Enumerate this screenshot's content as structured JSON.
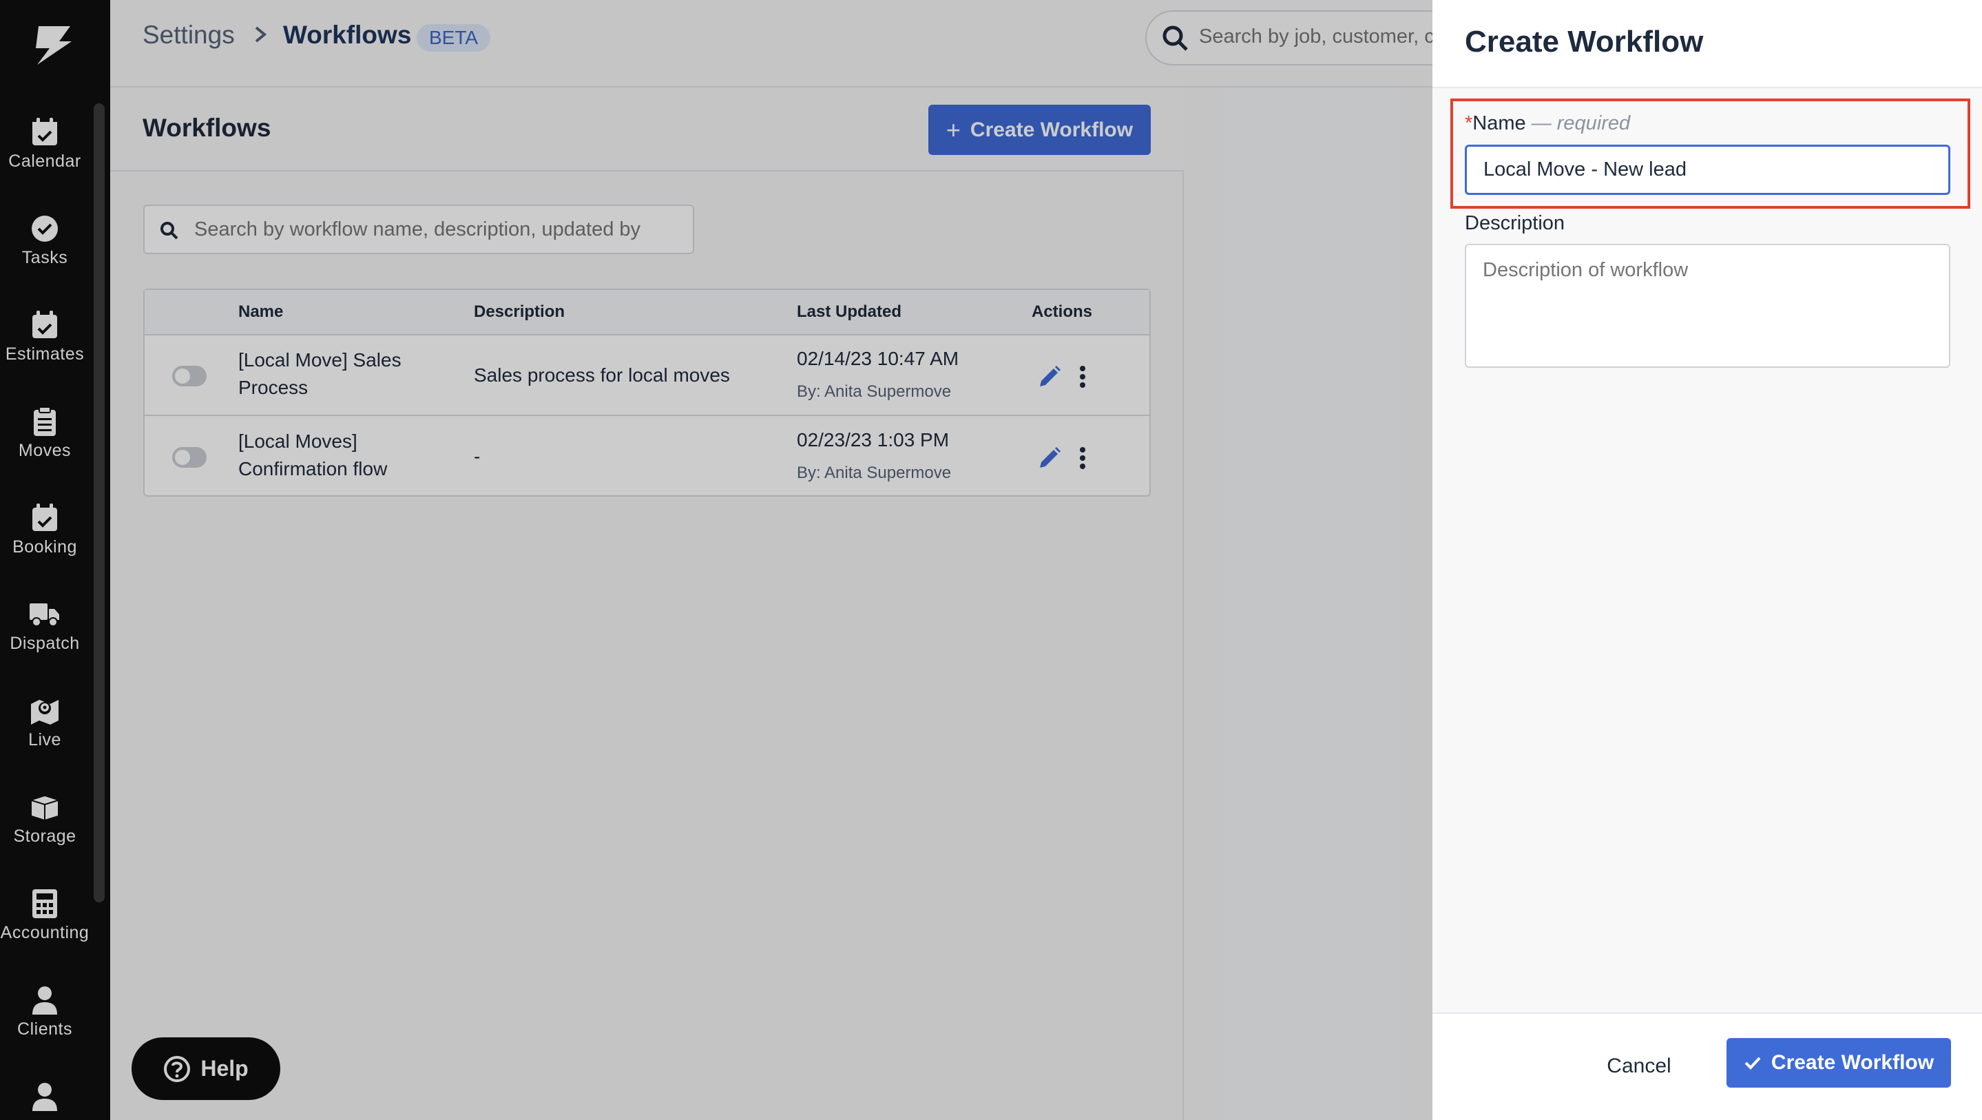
{
  "sidebar": {
    "items": [
      {
        "label": "Calendar",
        "icon": "calendar-check-icon"
      },
      {
        "label": "Tasks",
        "icon": "check-circle-icon"
      },
      {
        "label": "Estimates",
        "icon": "calendar-check-icon"
      },
      {
        "label": "Moves",
        "icon": "clipboard-icon"
      },
      {
        "label": "Booking",
        "icon": "calendar-check-icon"
      },
      {
        "label": "Dispatch",
        "icon": "truck-icon"
      },
      {
        "label": "Live",
        "icon": "map-pin-icon"
      },
      {
        "label": "Storage",
        "icon": "box-icon"
      },
      {
        "label": "Accounting",
        "icon": "calculator-icon"
      },
      {
        "label": "Clients",
        "icon": "user-icon"
      }
    ]
  },
  "header": {
    "breadcrumb_settings": "Settings",
    "breadcrumb_current": "Workflows",
    "badge": "BETA",
    "search_placeholder": "Search by job, customer, c"
  },
  "workflows_panel": {
    "title": "Workflows",
    "create_button": "Create Workflow",
    "search_placeholder": "Search by workflow name, description, updated by",
    "columns": [
      "Name",
      "Description",
      "Last Updated",
      "Actions"
    ],
    "rows": [
      {
        "name": "[Local Move] Sales Process",
        "description": "Sales process for local moves",
        "updated": "02/14/23 10:47 AM",
        "updated_by": "By: Anita Supermove",
        "enabled": false
      },
      {
        "name": "[Local Moves] Confirmation flow",
        "description": "-",
        "updated": "02/23/23 1:03 PM",
        "updated_by": "By: Anita Supermove",
        "enabled": false
      }
    ]
  },
  "help_button": "Help",
  "drawer": {
    "title": "Create Workflow",
    "name_label_star": "*",
    "name_label": "Name",
    "name_required": " — required",
    "name_value": "Local Move - New lead",
    "description_label": "Description",
    "description_placeholder": "Description of workflow",
    "cancel_button": "Cancel",
    "submit_button": "Create Workflow"
  },
  "colors": {
    "sidebar_bg": "#0f0f0f",
    "primary": "#3f6bd6",
    "highlight_border": "#e0412d",
    "text": "#1e2a3d"
  }
}
